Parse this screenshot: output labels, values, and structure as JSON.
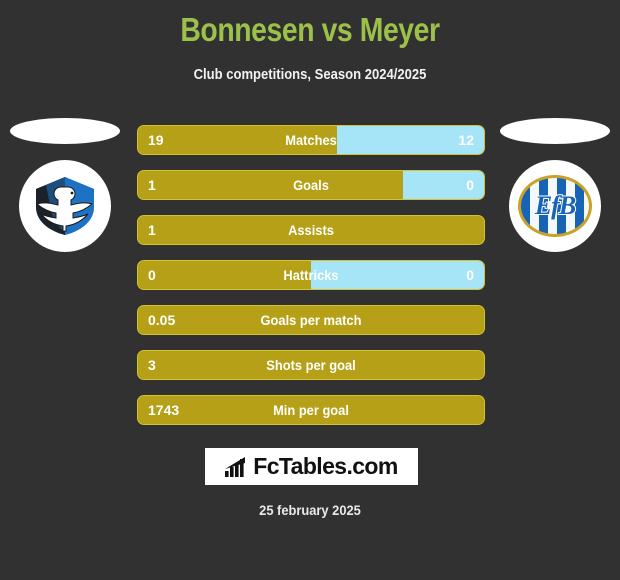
{
  "header": {
    "title": "Bonnesen vs Meyer",
    "subtitle": "Club competitions, Season 2024/2025",
    "title_color": "#9cc04a"
  },
  "crests": {
    "home": {
      "name": "home-club-crest",
      "alt": "blue and black shield with white swan",
      "colors": {
        "primary": "#1e72c4",
        "secondary": "#1b1b1b",
        "bird": "#ffffff"
      }
    },
    "away": {
      "name": "away-club-crest",
      "alt": "EfB blue and white striped oval crest",
      "monogram": "EfB",
      "colors": {
        "primary": "#1763b5",
        "secondary": "#f4f7fb",
        "ring": "#c9a227"
      }
    }
  },
  "colors": {
    "background": "#313131",
    "bar_home": "#b5a018",
    "bar_away": "#a6e4f7",
    "bar_border": "#d4c32e"
  },
  "stats": [
    {
      "label": "Matches",
      "home": "19",
      "away": "12",
      "home_pct": 57.5,
      "has_away": true
    },
    {
      "label": "Goals",
      "home": "1",
      "away": "0",
      "home_pct": 76.5,
      "has_away": true
    },
    {
      "label": "Assists",
      "home": "1",
      "away": "",
      "home_pct": 100,
      "has_away": false
    },
    {
      "label": "Hattricks",
      "home": "0",
      "away": "0",
      "home_pct": 50,
      "has_away": true
    },
    {
      "label": "Goals per match",
      "home": "0.05",
      "away": "",
      "home_pct": 100,
      "has_away": false
    },
    {
      "label": "Shots per goal",
      "home": "3",
      "away": "",
      "home_pct": 100,
      "has_away": false
    },
    {
      "label": "Min per goal",
      "home": "1743",
      "away": "",
      "home_pct": 100,
      "has_away": false
    }
  ],
  "footer": {
    "brand": "FcTables.com",
    "date": "25 february 2025"
  }
}
